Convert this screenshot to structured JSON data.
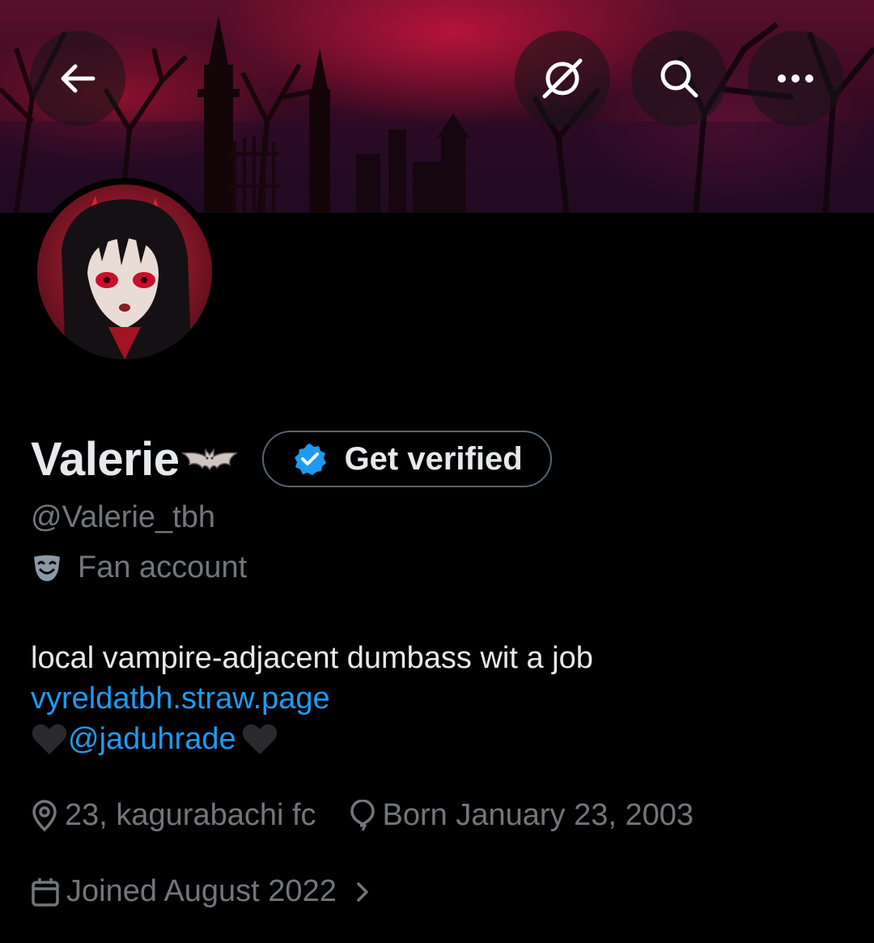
{
  "topbar": {
    "back_icon": "arrow-left-icon",
    "grok_icon": "grok-icon",
    "search_icon": "search-icon",
    "more_icon": "more-horizontal-icon"
  },
  "profile": {
    "display_name": "Valerie",
    "name_emoji": "bat-emoji",
    "verify_button_label": "Get verified",
    "handle": "@Valerie_tbh",
    "category": "Fan account",
    "bio": {
      "line1": "local vampire-adjacent dumbass wit a job",
      "link": "vyreldatbh.straw.page",
      "mention": "@jaduhrade"
    },
    "location": "23, kagurabachi fc",
    "birth": "Born January 23, 2003",
    "joined": "Joined August 2022"
  },
  "colors": {
    "background": "#000000",
    "text_primary": "#e7e9ea",
    "text_secondary": "#71767b",
    "link": "#1d9bf0",
    "verified_badge": "#1d9bf0"
  }
}
